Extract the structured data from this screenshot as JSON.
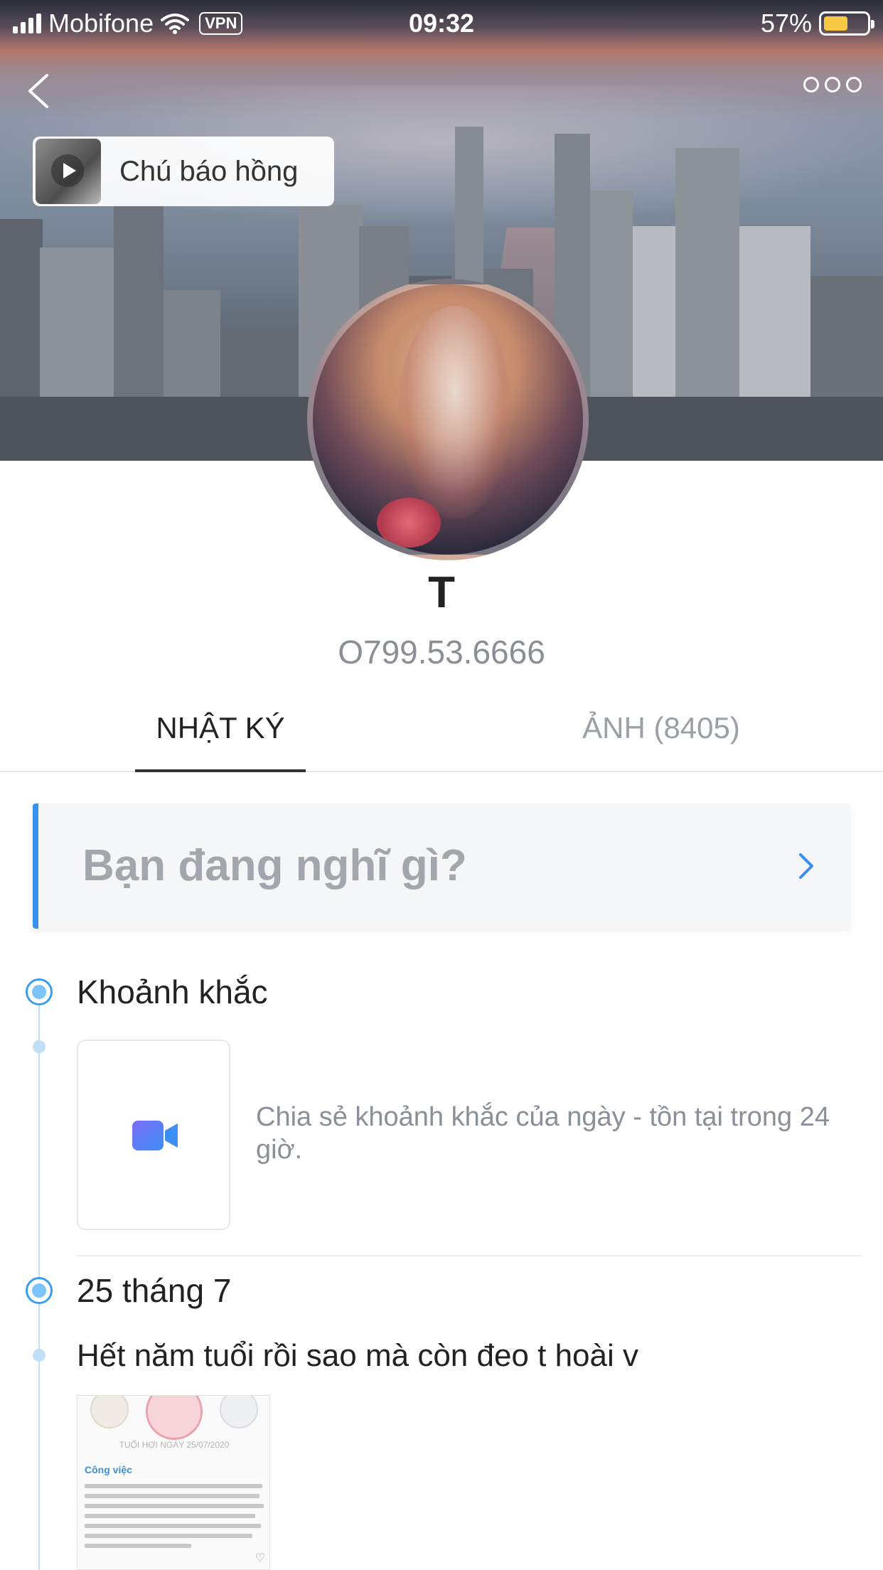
{
  "status_bar": {
    "carrier": "Mobifone",
    "vpn": "VPN",
    "time": "09:32",
    "battery": "57%",
    "battery_level": 0.57
  },
  "cover": {
    "music_title": "Chú báo hồng"
  },
  "profile": {
    "name": "T",
    "phone": "O799.53.6666"
  },
  "tabs": [
    {
      "label": "NHẬT KÝ",
      "active": true
    },
    {
      "label": "ẢNH (8405)",
      "active": false
    }
  ],
  "composer": {
    "placeholder": "Bạn đang nghĩ gì?"
  },
  "moments": {
    "title": "Khoảnh khắc",
    "description": "Chia sẻ khoảnh khắc của ngày - tồn tại trong 24 giờ."
  },
  "post": {
    "date": "25 tháng 7",
    "text": "Hết năm tuổi rồi sao mà còn đeo t hoài v",
    "image": {
      "caption": "TUỔI HỢI NGÀY 25/07/2020",
      "heading": "Công việc"
    }
  },
  "colors": {
    "accent": "#3a8ff3",
    "timeline": "#bfe0f7",
    "battery": "#f7c945"
  }
}
